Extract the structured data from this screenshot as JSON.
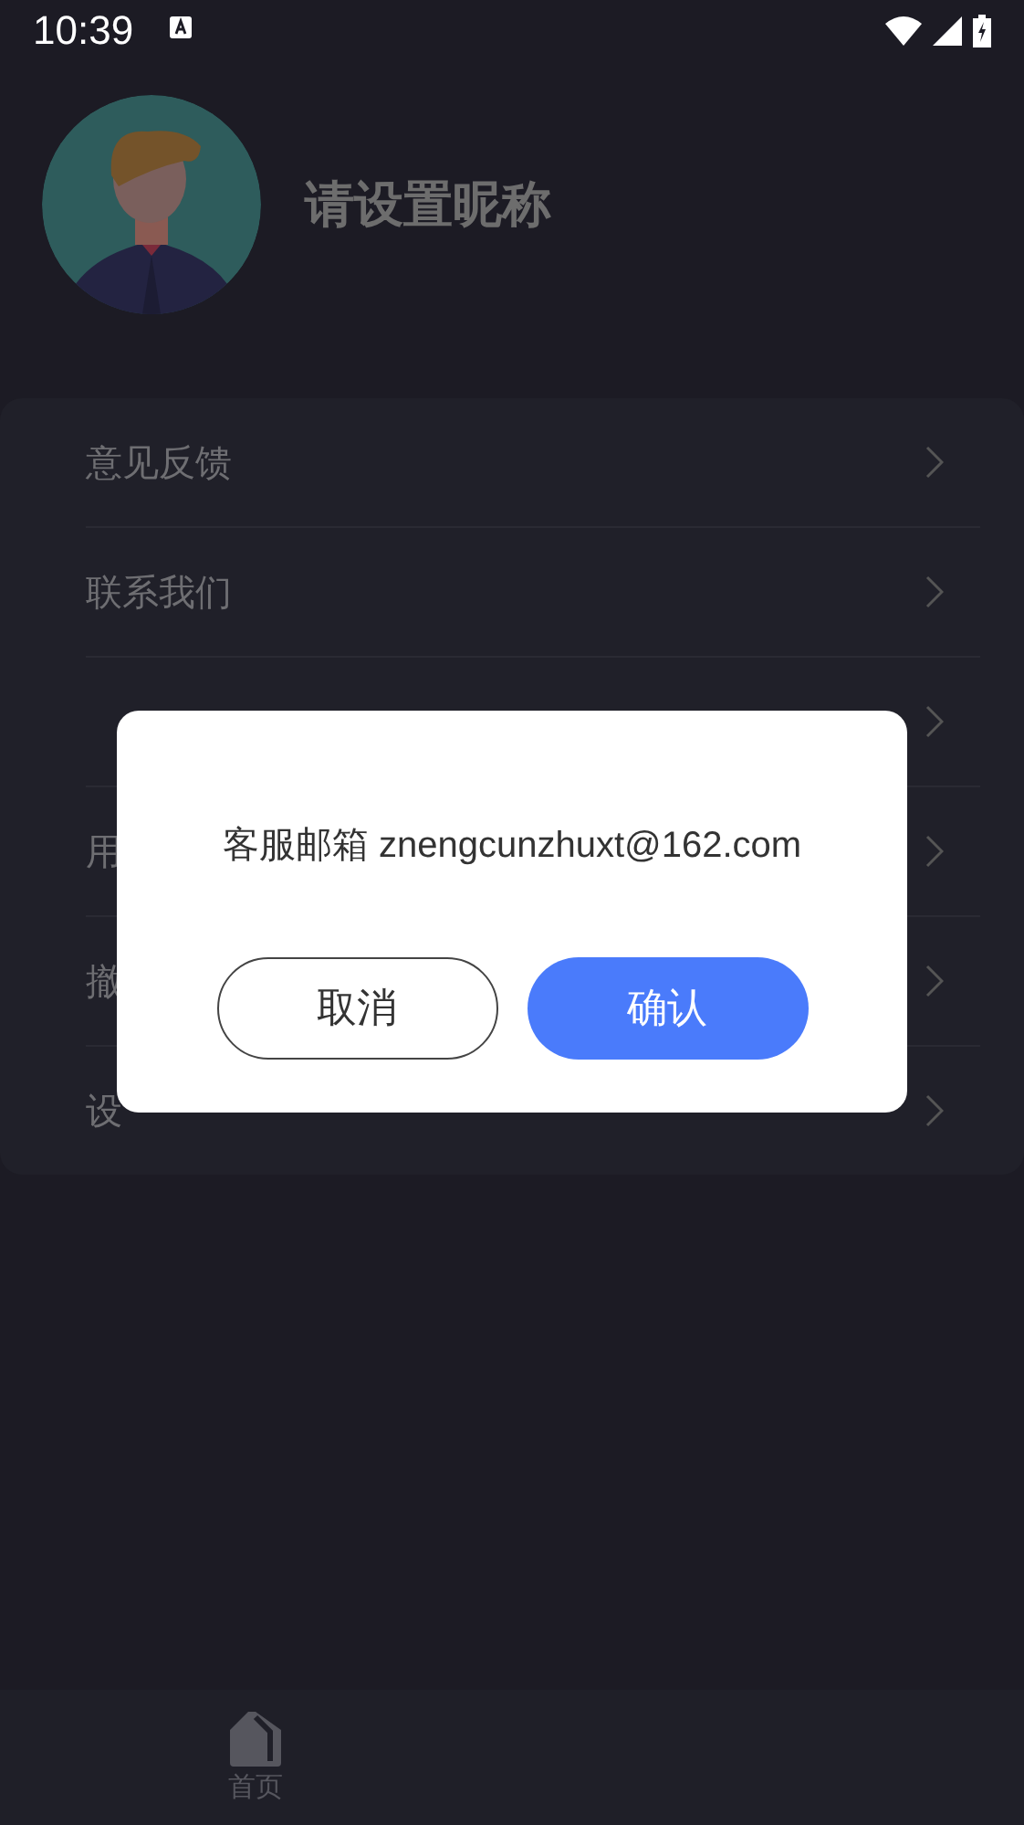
{
  "status_bar": {
    "time": "10:39"
  },
  "profile": {
    "nickname": "请设置昵称"
  },
  "menu": [
    {
      "kind": "text",
      "label": "意见反馈"
    },
    {
      "kind": "text",
      "label": "联系我们"
    },
    {
      "kind": "covered"
    },
    {
      "kind": "text",
      "label": "用"
    },
    {
      "kind": "text",
      "label": "撤"
    },
    {
      "kind": "text",
      "label": "设"
    }
  ],
  "dialog": {
    "message": "客服邮箱 znengcunzhuxt@162.com",
    "buttons": [
      {
        "label": "取消",
        "kind": "secondary"
      },
      {
        "label": "确认",
        "kind": "primary"
      }
    ]
  },
  "bottom_nav": [
    {
      "label": "首页",
      "selected": false
    }
  ]
}
